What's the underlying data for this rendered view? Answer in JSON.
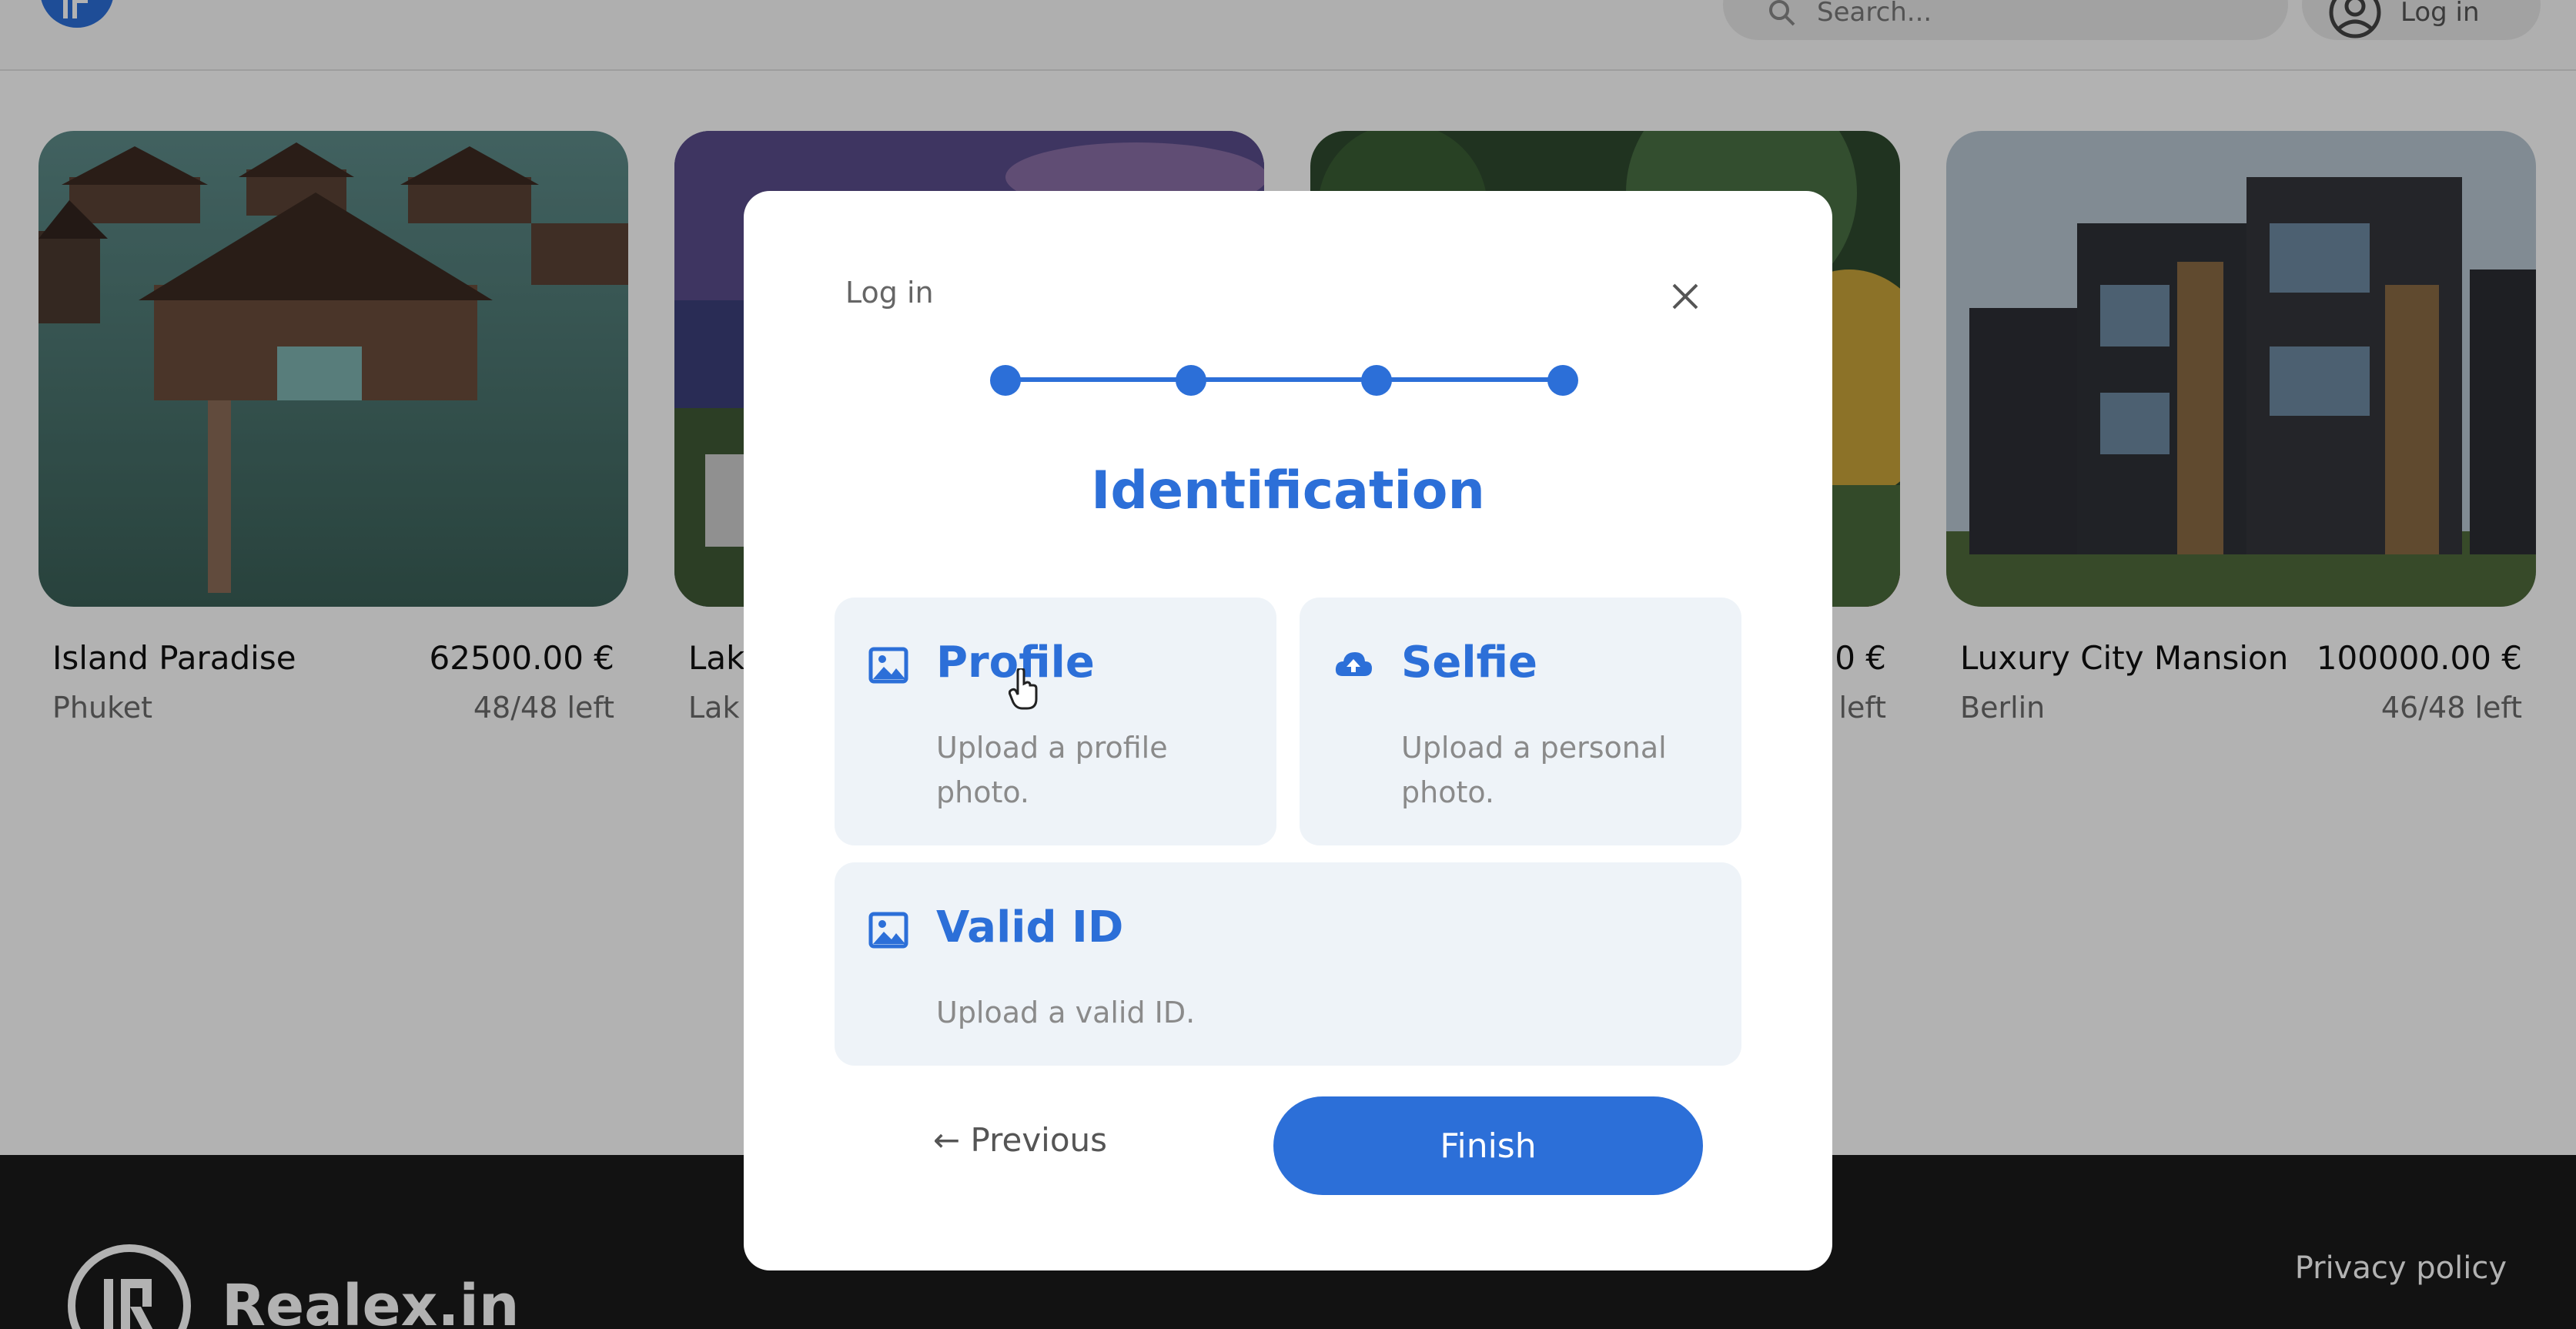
{
  "header": {
    "search_placeholder": "Search...",
    "login_label": "Log in"
  },
  "listings": [
    {
      "title": "Island Paradise",
      "price": "62500.00 €",
      "location": "Phuket",
      "availability": "48/48 left"
    },
    {
      "title": "Lak",
      "price": "",
      "location": "Lak",
      "availability": ""
    },
    {
      "title": "",
      "price": "0 €",
      "location": "",
      "availability": "left"
    },
    {
      "title": "Luxury City Mansion",
      "price": "100000.00 €",
      "location": "Berlin",
      "availability": "46/48 left"
    }
  ],
  "footer": {
    "brand": "Realex.in",
    "privacy": "Privacy policy"
  },
  "modal": {
    "title": "Log in",
    "heading": "Identification",
    "steps_total": 4,
    "options": [
      {
        "label": "Profile",
        "desc": "Upload a profile photo.",
        "icon": "image-icon"
      },
      {
        "label": "Selfie",
        "desc": "Upload a personal photo.",
        "icon": "cloud-upload-icon"
      },
      {
        "label": "Valid ID",
        "desc": "Upload a valid ID.",
        "icon": "image-icon"
      }
    ],
    "previous_label": "← Previous",
    "finish_label": "Finish"
  },
  "colors": {
    "accent": "#2c6fd8",
    "option_bg": "#eef3f8",
    "footer_bg": "#1a1a1a"
  }
}
